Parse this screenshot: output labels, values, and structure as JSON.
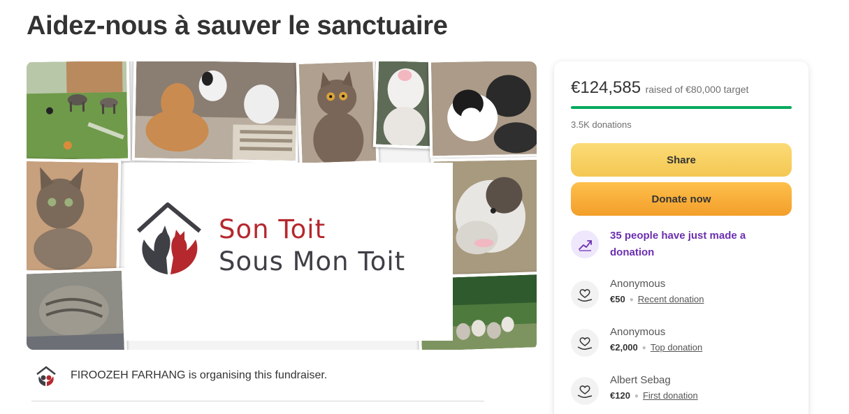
{
  "page": {
    "title": "Aidez-nous à sauver le sanctuaire"
  },
  "hero": {
    "brand_line1": "Son Toit",
    "brand_line2": "Sous Mon Toit",
    "brand_colors": {
      "red": "#b5282e",
      "dark": "#3f3f46"
    },
    "photos": [
      "donkeys-in-field",
      "two-dogs-on-bed",
      "grey-cat",
      "white-rat",
      "black-white-cats",
      "tabby-kitten",
      "old-dog",
      "sleeping-tabby-cat",
      "geese-in-park"
    ]
  },
  "organiser": {
    "text": "FIROOZEH FARHANG is organising this fundraiser."
  },
  "donation_card": {
    "raised_amount": "€124,585",
    "raised_suffix": "raised of €80,000 target",
    "progress_fraction": 1.0,
    "donations_count": "3.5K donations",
    "share_label": "Share",
    "donate_label": "Donate now",
    "trend_text": "35 people have just made a donation",
    "donations": [
      {
        "name": "Anonymous",
        "amount": "€50",
        "tag": "Recent donation"
      },
      {
        "name": "Anonymous",
        "amount": "€2,000",
        "tag": "Top donation"
      },
      {
        "name": "Albert Sebag",
        "amount": "€120",
        "tag": "First donation"
      }
    ],
    "colors": {
      "progress": "#02a95c",
      "share": "#f4c753",
      "donate": "#f39e2a",
      "trend": "#6b2fb0"
    }
  }
}
